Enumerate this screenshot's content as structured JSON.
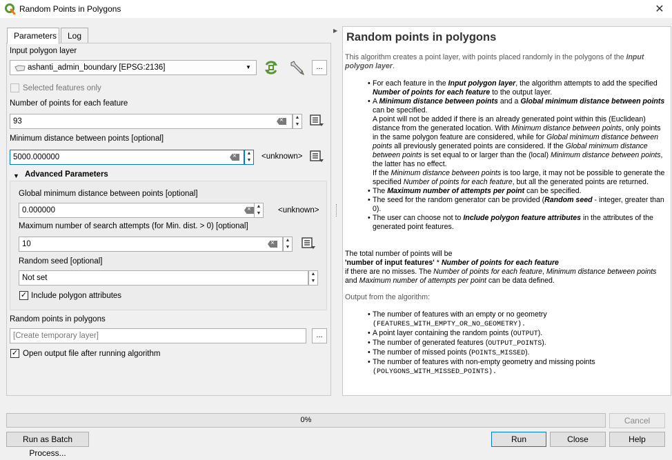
{
  "window": {
    "title": "Random Points in Polygons",
    "close_glyph": "✕"
  },
  "tabs": [
    {
      "label": "Parameters"
    },
    {
      "label": "Log"
    }
  ],
  "params": {
    "input_layer_label": "Input polygon layer",
    "input_layer_value": "ashanti_admin_boundary [EPSG:2136]",
    "selected_only_label": "Selected features only",
    "num_points_label": "Number of points for each feature",
    "num_points_value": "93",
    "min_dist_label": "Minimum distance between points [optional]",
    "min_dist_value": "5000.000000",
    "min_dist_unit": "<unknown>",
    "advanced_label": "Advanced Parameters",
    "global_min_label": "Global minimum distance between points [optional]",
    "global_min_value": "0.000000",
    "global_min_unit": "<unknown>",
    "max_attempts_label": "Maximum number of search attempts (for Min. dist. > 0) [optional]",
    "max_attempts_value": "10",
    "seed_label": "Random seed [optional]",
    "seed_value": "Not set",
    "include_attrs_label": "Include polygon attributes",
    "output_label": "Random points in polygons",
    "output_placeholder": "[Create temporary layer]",
    "open_output_label": "Open output file after running algorithm",
    "dots": "..."
  },
  "help": {
    "title": "Random points in polygons",
    "intro_a": "This algorithm creates a point layer, with points placed randomly in the polygons of the ",
    "intro_b": "Input polygon layer",
    "intro_c": ".",
    "b1_a": "For each feature in the ",
    "b1_b": "Input polygon layer",
    "b1_c": ", the algorithm attempts to add the specified ",
    "b1_d": "Number of points for each feature",
    "b1_e": " to the output layer.",
    "b2_a": "A ",
    "b2_b": "Minimum distance between points",
    "b2_c": " and a ",
    "b2_d": "Global minimum distance between points",
    "b2_e": " can be specified.",
    "b2_p1a": "A point will not be added if there is an already generated point within this (Euclidean) distance from the generated location. With ",
    "b2_p1b": "Minimum distance between points",
    "b2_p1c": ", only points in the same polygon feature are considered, while for ",
    "b2_p1d": "Global minimum distance between points",
    "b2_p1e": " all previously generated points are considered. If the ",
    "b2_p1f": "Global minimum distance between points",
    "b2_p1g": " is set equal to or larger than the (local) ",
    "b2_p1h": "Minimum distance between points",
    "b2_p1i": ", the latter has no effect.",
    "b2_p2a": "If the ",
    "b2_p2b": "Minimum distance between points",
    "b2_p2c": " is too large, it may not be possible to generate the specified ",
    "b2_p2d": "Number of points for each feature",
    "b2_p2e": ", but all the generated points are returned.",
    "b3_a": "The ",
    "b3_b": "Maximum number of attempts per point",
    "b3_c": " can be specified.",
    "b4_a": "The seed for the random generator can be provided (",
    "b4_b": "Random seed",
    "b4_c": " - integer, greater than 0).",
    "b5_a": "The user can choose not to ",
    "b5_b": "Include polygon feature attributes",
    "b5_c": " in the attributes of the generated point features.",
    "total_1": "The total number of points will be",
    "total_2a": "'number of input features'",
    "total_2b": " * ",
    "total_2c": "Number of points for each feature",
    "total_3a": "if there are no misses. The ",
    "total_3b": "Number of points for each feature",
    "total_3c": ", ",
    "total_3d": "Minimum distance between points",
    "total_3e": " and ",
    "total_3f": "Maximum number of attempts per point",
    "total_3g": " can be data defined.",
    "output_heading": "Output from the algorithm:",
    "o1a": "The number of features with an empty or no geometry",
    "o1b": "(FEATURES_WITH_EMPTY_OR_NO_GEOMETRY).",
    "o2a": "A point layer containing the random points (",
    "o2b": "OUTPUT",
    "o2c": ").",
    "o3a": "The number of generated features (",
    "o3b": "OUTPUT_POINTS",
    "o3c": ").",
    "o4a": "The number of missed points (",
    "o4b": "POINTS_MISSED",
    "o4c": ").",
    "o5a": "The number of features with non-empty geometry and missing points",
    "o5b": "(POLYGONS_WITH_MISSED_POINTS)."
  },
  "progress": {
    "label": "0%",
    "value": 0
  },
  "buttons": {
    "cancel": "Cancel",
    "batch": "Run as Batch Process...",
    "run": "Run",
    "close": "Close",
    "help": "Help"
  },
  "colors": {
    "accent_focus": "#0078d7",
    "qgis_green": "#589632",
    "qgis_yellow": "#ee7913"
  }
}
